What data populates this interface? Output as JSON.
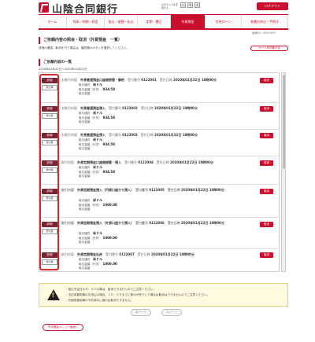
{
  "header": {
    "bank_name": "山陰合同銀行",
    "font_size_label": "文字サイズを変更する",
    "font_sizes": [
      "小",
      "中",
      "大"
    ],
    "logout_label": "ログアウト"
  },
  "nav": {
    "items": [
      {
        "label": "ホーム"
      },
      {
        "label": "残高・明細・照会"
      },
      {
        "label": "振込・振替・払込"
      },
      {
        "label": "定期・積立"
      },
      {
        "label": "外貨預金"
      },
      {
        "label": "住宅ローン"
      },
      {
        "label": "各種お申込・手続き"
      }
    ]
  },
  "screen_no": "画面ID：BGS0003",
  "page_title": "ご依頼内容の照会・取消（外貨預金　一覧）",
  "page_desc": "詳細の確認、取消を行う場合は、最終欄のボタンを選択してください。",
  "page_move_label": "ページを印刷する",
  "list_title": "ご依頼内容の一覧",
  "date_range": "2020年01月22日～2020年01月22日",
  "buttons": {
    "detail": "詳細",
    "receipt": "受付票",
    "cancel": "取消"
  },
  "labels": {
    "receipt_no": "受付番号",
    "receipt_date": "受付日時",
    "currency": "取引通貨",
    "amount": "取引金額（外貨）",
    "tx_amount": "取引金額"
  },
  "records": [
    {
      "type_label": "お取引内容",
      "content": "外貨普通預金口座間振替・解約",
      "receipt_no": "0122001",
      "date": "2020年01月22日 10時00分",
      "currency": "米ドル",
      "amount": "934.58",
      "tx_amount": ""
    },
    {
      "type_label": "お取引内容",
      "content": "外貨普通預金預入",
      "receipt_no": "0122002",
      "date": "2020年01月22日 10時00分",
      "currency": "米ドル",
      "amount": "934.58",
      "tx_amount": ""
    },
    {
      "type_label": "お取引内容",
      "content": "外貨普通預金預入",
      "receipt_no": "0122003",
      "date": "2020年01月22日 10時00分",
      "currency": "米ドル",
      "amount": "934.58",
      "tx_amount": ""
    },
    {
      "type_label": "取引内容",
      "content": "外貨定期預金口座間振替・預入",
      "receipt_no": "0122004",
      "date": "2020年01月22日 10時00分",
      "currency": "米ドル",
      "amount": "934.58",
      "tx_amount": ""
    },
    {
      "type_label": "取引内容",
      "content": "外貨定期預金預入（円貨口座から預入）",
      "receipt_no": "0122005",
      "date": "2020年01月22日 10時00分",
      "currency": "米ドル",
      "amount": "1000.00",
      "tx_amount": ""
    },
    {
      "type_label": "取引内容",
      "content": "外貨定期預金預入（外貨口座から預入）",
      "receipt_no": "0122006",
      "date": "2020年01月22日 10時00分",
      "currency": "米ドル",
      "amount": "1000.00",
      "tx_amount": ""
    },
    {
      "type_label": "取引内容",
      "content": "外貨定期預金払戻",
      "receipt_no": "0122007",
      "date": "2020年01月22日 10時00分",
      "currency": "米ドル",
      "amount": "1000.00",
      "tx_amount": ""
    }
  ],
  "notice": [
    "・取引予定日の９：５５以降は、取消できませんのでご注意ください。",
    "・当日為替相場のお申込の場合、１０：００までに取引が完了した場合は取消はできませんのでご注意ください。",
    "・外国為替相場の予約済みに取引は取消できません。"
  ],
  "pager": {
    "prev": "前ページ",
    "next": "次ページ"
  },
  "back_label": "外貨預金メニュー画面へ"
}
